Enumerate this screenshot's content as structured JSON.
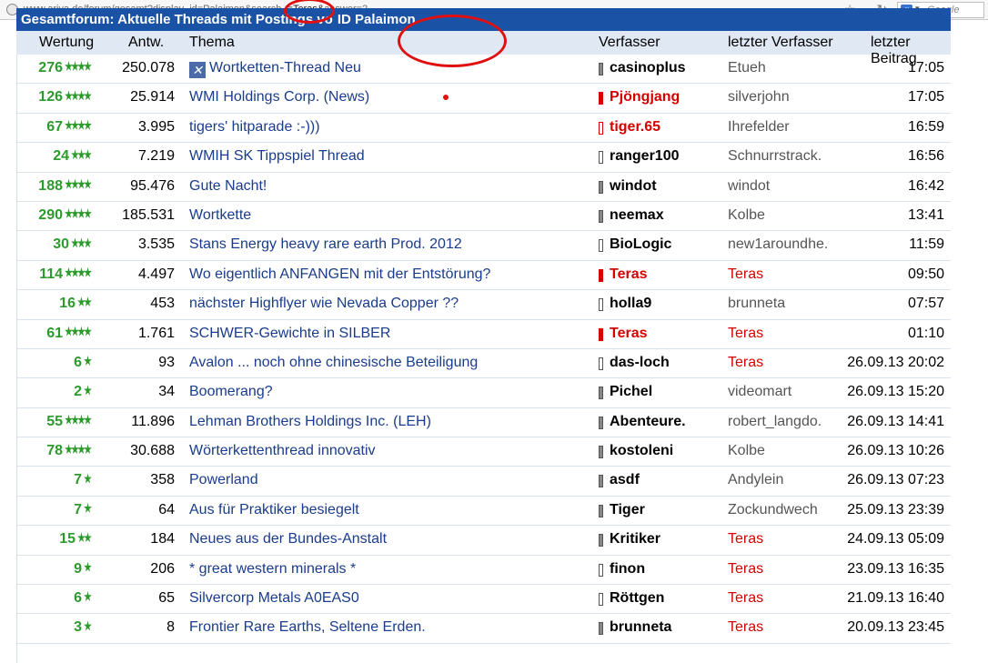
{
  "browser": {
    "url_prefix": "www.ariva.de/forum/gesamt?display_id=Palaimon&search_",
    "url_mid": "=Teras&",
    "url_suffix": "answer=2",
    "search_placeholder": "Google",
    "search_engine_letter": "g"
  },
  "banner": {
    "prefix": "Gesamtforum: Aktuelle Threads mit Postings vo",
    "highlight": "ID Palaimon"
  },
  "columns": {
    "wertung": "Wertung",
    "antw": "Antw.",
    "thema": "Thema",
    "verfasser": "Verfasser",
    "letzter_verfasser": "letzter Verfasser",
    "letzter_beitrag": "letzter Beitrag"
  },
  "rows": [
    {
      "score": "276",
      "stars": 4,
      "antw": "250.078",
      "thema": "Wortketten-Thread Neu",
      "icon": "x-icon",
      "author": "casinoplus",
      "author_red": false,
      "bar": "dark",
      "last": "Etueh",
      "last_red": false,
      "date": "17:05"
    },
    {
      "score": "126",
      "stars": 4,
      "antw": "25.914",
      "thema": "WMI Holdings Corp. (News)",
      "author": "Pjöngjang",
      "author_red": true,
      "bar": "red",
      "last": "silverjohn",
      "last_red": false,
      "date": "17:05"
    },
    {
      "score": "67",
      "stars": 4,
      "antw": "3.995",
      "thema": "tigers' hitparade :-)))",
      "author": "tiger.65",
      "author_red": true,
      "bar": "light",
      "last": "Ihrefelder",
      "last_red": false,
      "date": "16:59"
    },
    {
      "score": "24",
      "stars": 3,
      "antw": "7.219",
      "thema": "WMIH SK Tippspiel Thread",
      "author": "ranger100",
      "author_red": false,
      "bar": "light",
      "last": "Schnurrstrack.",
      "last_red": false,
      "date": "16:56"
    },
    {
      "score": "188",
      "stars": 4,
      "antw": "95.476",
      "thema": "Gute Nacht!",
      "author": "windot",
      "author_red": false,
      "bar": "dark",
      "last": "windot",
      "last_red": false,
      "date": "16:42"
    },
    {
      "score": "290",
      "stars": 4,
      "antw": "185.531",
      "thema": "Wortkette",
      "author": "neemax",
      "author_red": false,
      "bar": "dark",
      "last": "Kolbe",
      "last_red": false,
      "date": "13:41"
    },
    {
      "score": "30",
      "stars": 3,
      "antw": "3.535",
      "thema": "Stans Energy heavy rare earth Prod. 2012",
      "author": "BioLogic",
      "author_red": false,
      "bar": "light",
      "last": "new1aroundhe.",
      "last_red": false,
      "date": "11:59"
    },
    {
      "score": "114",
      "stars": 4,
      "antw": "4.497",
      "thema": "Wo eigentlich ANFANGEN mit der Entstörung?",
      "author": "Teras",
      "author_red": true,
      "bar": "red",
      "last": "Teras",
      "last_red": true,
      "date": "09:50"
    },
    {
      "score": "16",
      "stars": 2,
      "antw": "453",
      "thema": "nächster Highflyer wie Nevada Copper ??",
      "author": "holla9",
      "author_red": false,
      "bar": "light",
      "last": "brunneta",
      "last_red": false,
      "date": "07:57"
    },
    {
      "score": "61",
      "stars": 4,
      "antw": "1.761",
      "thema": "SCHWER-Gewichte in SILBER",
      "author": "Teras",
      "author_red": true,
      "bar": "red",
      "last": "Teras",
      "last_red": true,
      "date": "01:10"
    },
    {
      "score": "6",
      "stars": 1,
      "antw": "93",
      "thema": "Avalon ... noch ohne chinesische Beteiligung",
      "author": "das-loch",
      "author_red": false,
      "bar": "light",
      "last": "Teras",
      "last_red": true,
      "date": "26.09.13 20:02"
    },
    {
      "score": "2",
      "stars": 1,
      "antw": "34",
      "thema": "Boomerang?",
      "author": "Pichel",
      "author_red": false,
      "bar": "dark",
      "last": "videomart",
      "last_red": false,
      "date": "26.09.13 15:20"
    },
    {
      "score": "55",
      "stars": 4,
      "antw": "11.896",
      "thema": "Lehman Brothers Holdings Inc. (LEH)",
      "author": "Abenteure.",
      "author_red": false,
      "bar": "dark",
      "last": "robert_langdo.",
      "last_red": false,
      "date": "26.09.13 14:41"
    },
    {
      "score": "78",
      "stars": 4,
      "antw": "30.688",
      "thema": "Wörterkettenthread innovativ",
      "author": "kostoleni",
      "author_red": false,
      "bar": "dark",
      "last": "Kolbe",
      "last_red": false,
      "date": "26.09.13 10:26"
    },
    {
      "score": "7",
      "stars": 1,
      "antw": "358",
      "thema": "Powerland",
      "author": "asdf",
      "author_red": false,
      "bar": "dark",
      "last": "Andylein",
      "last_red": false,
      "date": "26.09.13 07:23"
    },
    {
      "score": "7",
      "stars": 1,
      "antw": "64",
      "thema": "Aus für Praktiker besiegelt",
      "author": "Tiger",
      "author_red": false,
      "bar": "dark",
      "last": "Zockundwech",
      "last_red": false,
      "date": "25.09.13 23:39"
    },
    {
      "score": "15",
      "stars": 2,
      "antw": "184",
      "thema": "Neues aus der Bundes-Anstalt",
      "author": "Kritiker",
      "author_red": false,
      "bar": "dark",
      "last": "Teras",
      "last_red": true,
      "date": "24.09.13 05:09"
    },
    {
      "score": "9",
      "stars": 1,
      "antw": "206",
      "thema": "* great western minerals *",
      "author": "finon",
      "author_red": false,
      "bar": "white",
      "last": "Teras",
      "last_red": true,
      "date": "23.09.13 16:35"
    },
    {
      "score": "6",
      "stars": 1,
      "antw": "65",
      "thema": "Silvercorp Metals A0EAS0",
      "author": "Röttgen",
      "author_red": false,
      "bar": "light",
      "last": "Teras",
      "last_red": true,
      "date": "21.09.13 16:40"
    },
    {
      "score": "3",
      "stars": 1,
      "antw": "8",
      "thema": "Frontier Rare Earths, Seltene Erden.",
      "author": "brunneta",
      "author_red": false,
      "bar": "dark",
      "last": "Teras",
      "last_red": true,
      "date": "20.09.13 23:45"
    }
  ],
  "colors": {
    "banner_bg": "#1a52a6",
    "header_bg": "#dfe8f3",
    "score_green": "#2e9a2e",
    "link_blue": "#1a3c8c",
    "red": "#d40000",
    "annotation_red": "#e01010"
  }
}
